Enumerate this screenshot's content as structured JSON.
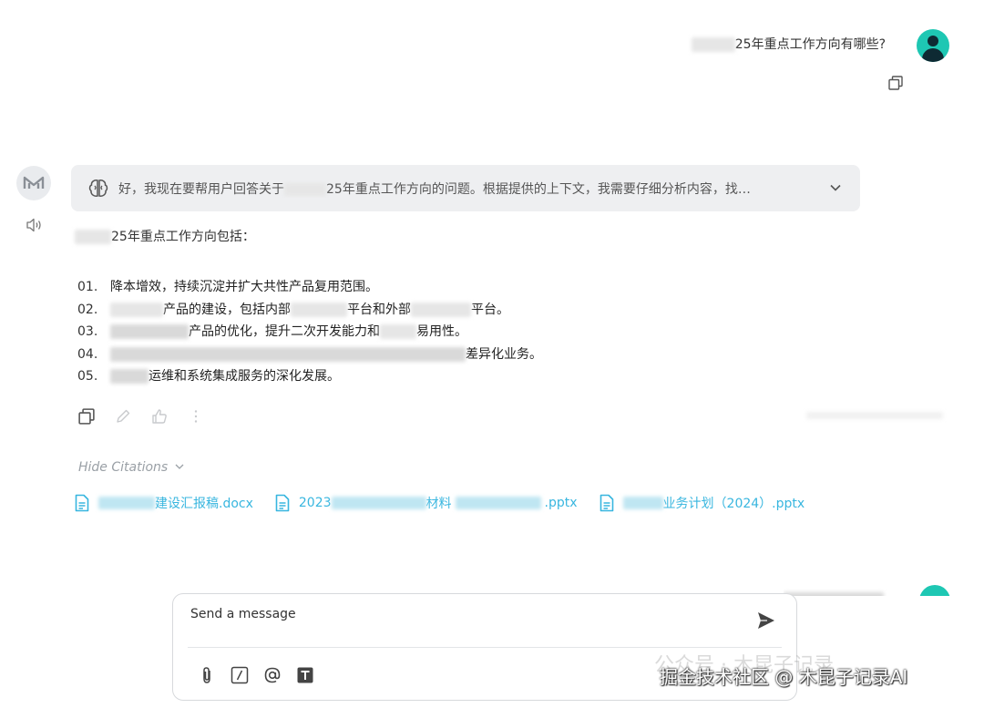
{
  "user_message": {
    "text": "25年重点工作方向有哪些?"
  },
  "assistant": {
    "thinking_text": "好，我现在要帮用户回答关于",
    "thinking_text2": "25年重点工作方向的问题。根据提供的上下文，我需要仔细分析内容，找…",
    "intro_suffix": "25年重点工作方向包括：",
    "items": [
      {
        "num": "01.",
        "pre": "",
        "text": "降本增效，持续沉淀并扩大共性产品复用范围。"
      },
      {
        "num": "02.",
        "pre": "",
        "text": "产品的建设，包括内部",
        "mid": "平台和外部",
        "tail": "平台。"
      },
      {
        "num": "03.",
        "pre": "",
        "text": "产品的优化，提升二次开发能力和",
        "tail": "易用性。"
      },
      {
        "num": "04.",
        "pre": "",
        "text": "差异化业务。"
      },
      {
        "num": "05.",
        "pre": "",
        "text": "运维和系统集成服务的深化发展。"
      }
    ]
  },
  "citations_toggle": "Hide Citations",
  "citations": [
    {
      "name_end": "建设汇报稿.docx"
    },
    {
      "name_start": "2023",
      "name_mid": "材料",
      "name_end": ".pptx"
    },
    {
      "name_end": "业务计划（2024）.pptx"
    }
  ],
  "input": {
    "placeholder": "Send a message"
  },
  "icons": {
    "user_avatar": "user-avatar-icon",
    "copy": "copy-icon",
    "bot": "bot-logo-icon",
    "speaker": "speaker-icon",
    "brain": "brain-icon",
    "chevron": "chevron-down-icon",
    "edit": "pencil-icon",
    "like": "thumbs-up-icon",
    "more": "more-vertical-icon",
    "doc": "document-icon",
    "send": "send-icon",
    "attach": "paperclip-icon",
    "slash": "slash-command-icon",
    "mention": "at-icon",
    "text": "text-format-icon"
  },
  "colors": {
    "accent": "#1ec7b3",
    "link": "#38b6df",
    "thinking_bg": "#eeeff1"
  },
  "watermark": {
    "text": "掘金技术社区 @ 木昆子记录AI",
    "faint": "公众号 · 木昆子记录"
  }
}
